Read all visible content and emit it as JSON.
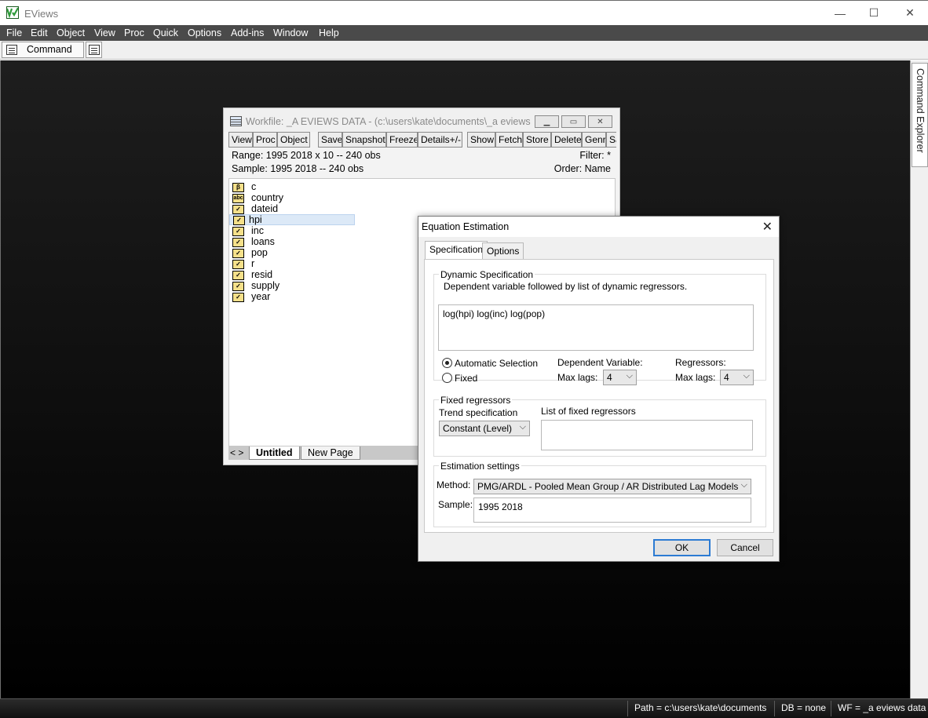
{
  "app": {
    "title": "EViews",
    "logo": "eviews-logo",
    "accent": "#2e9b3a"
  },
  "menu": [
    "File",
    "Edit",
    "Object",
    "View",
    "Proc",
    "Quick",
    "Options",
    "Add-ins",
    "Window",
    "Help"
  ],
  "command_bar": {
    "tab_label": "Command"
  },
  "side_panel": {
    "label": "Command Explorer"
  },
  "status": {
    "path": "Path = c:\\users\\kate\\documents",
    "db": "DB = none",
    "wf": "WF = _a eviews data"
  },
  "workfile": {
    "title": "Workfile: _A EVIEWS DATA - (c:\\users\\kate\\documents\\_a eviews da...",
    "toolbar": [
      "View",
      "Proc",
      "Object",
      "Save",
      "Snapshot",
      "Freeze",
      "Details+/-",
      "Show",
      "Fetch",
      "Store",
      "Delete",
      "Genr",
      "Sa"
    ],
    "range": "Range:  1995 2018 x 10   --   240 obs",
    "sample": "Sample: 1995 2018   --   240 obs",
    "filter": "Filter: *",
    "order": "Order: Name",
    "items": [
      {
        "name": "c",
        "icon": "coef-icon",
        "glyph": "β"
      },
      {
        "name": "country",
        "icon": "alpha-series-icon",
        "glyph": "abc"
      },
      {
        "name": "dateid",
        "icon": "series-icon",
        "glyph": "✓"
      },
      {
        "name": "hpi",
        "icon": "series-icon",
        "glyph": "✓"
      },
      {
        "name": "inc",
        "icon": "series-icon",
        "glyph": "✓"
      },
      {
        "name": "loans",
        "icon": "series-icon",
        "glyph": "✓"
      },
      {
        "name": "pop",
        "icon": "series-icon",
        "glyph": "✓"
      },
      {
        "name": "r",
        "icon": "series-icon",
        "glyph": "✓"
      },
      {
        "name": "resid",
        "icon": "series-icon",
        "glyph": "✓"
      },
      {
        "name": "supply",
        "icon": "series-icon",
        "glyph": "✓"
      },
      {
        "name": "year",
        "icon": "series-icon",
        "glyph": "✓"
      }
    ],
    "selected_item": "hpi",
    "page_nav": "< >",
    "pages": [
      "Untitled",
      "New Page"
    ],
    "active_page": "Untitled"
  },
  "dialog": {
    "title": "Equation Estimation",
    "tabs": [
      "Specification",
      "Options"
    ],
    "active_tab": "Specification",
    "dynamic_spec": {
      "title": "Dynamic Specification",
      "hint": "Dependent variable followed by list of dynamic regressors.",
      "value": "log(hpi) log(inc) log(pop)"
    },
    "lag_selection": {
      "automatic_label": "Automatic Selection",
      "fixed_label": "Fixed",
      "selected": "Automatic Selection",
      "dep_var_label": "Dependent Variable:",
      "dep_max_lags_label": "Max lags:",
      "dep_max_lags": "4",
      "regressors_label": "Regressors:",
      "reg_max_lags_label": "Max lags:",
      "reg_max_lags": "4"
    },
    "fixed_regressors": {
      "title": "Fixed regressors",
      "trend_label": "Trend specification",
      "trend_value": "Constant (Level)",
      "list_label": "List of fixed regressors",
      "list_value": ""
    },
    "estimation": {
      "title": "Estimation settings",
      "method_label": "Method:",
      "method_value": "PMG/ARDL  -  Pooled Mean Group / AR Distributed Lag Models",
      "sample_label": "Sample:",
      "sample_value": "1995 2018"
    },
    "ok_label": "OK",
    "cancel_label": "Cancel"
  }
}
